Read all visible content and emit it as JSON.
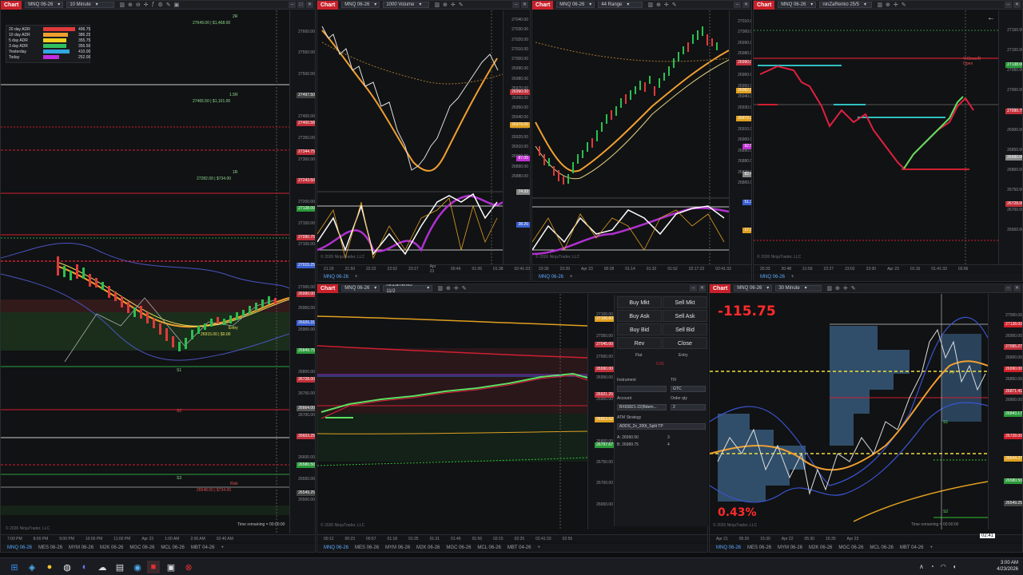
{
  "windows": {
    "w1": {
      "badge": "Chart",
      "instrument": "MNQ 06-26",
      "interval": "10 Minute",
      "adr_rows": [
        {
          "label": "20 day ADR",
          "value": "496.75",
          "color": "#e23a3a",
          "fill": 1.0
        },
        {
          "label": "10 day ADR",
          "value": "386.25",
          "color": "#f0a030",
          "fill": 0.78
        },
        {
          "label": "5 day ADR",
          "value": "355.75",
          "color": "#f0d020",
          "fill": 0.72
        },
        {
          "label": "3 day ADR",
          "value": "356.50",
          "color": "#30c060",
          "fill": 0.72
        },
        {
          "label": "Yesterday",
          "value": "410.00",
          "color": "#30a8e0",
          "fill": 0.83
        },
        {
          "label": "Today",
          "value": "252.00",
          "color": "#c030e0",
          "fill": 0.51
        }
      ],
      "annotations": {
        "r2": "2R",
        "r2v": "27649.00 | $1,468.00",
        "r15": "1.5R",
        "r15v": "27465.50 | $1,101.00",
        "r1": "1R",
        "r1v": "27282.00 | $734.00",
        "entry": "Entry",
        "entryv": "26915.00 | $0.00",
        "s1": "S1",
        "s2": "S2",
        "s3": "S3",
        "risk": "Risk",
        "riskv": "26548.00 | $734.00"
      },
      "ticks": [
        "27600.00",
        "27550.00",
        "27500.00",
        "27450.00",
        "27400.00",
        "27350.00",
        "27300.00",
        "27250.00",
        "27200.00",
        "27150.00",
        "27100.00",
        "27050.00",
        "27000.00",
        "26950.00",
        "26900.00",
        "26850.00",
        "26800.00",
        "26750.00",
        "26700.00",
        "26650.00",
        "26600.00",
        "26550.00",
        "26500.00"
      ],
      "pl": [
        {
          "text": "27497.50",
          "bg": "#444"
        },
        {
          "text": "27400.58",
          "bg": "#c0303a"
        },
        {
          "text": "27344.75",
          "bg": "#c0303a"
        },
        {
          "text": "27243.50",
          "bg": "#c0303a"
        },
        {
          "text": "27138.00",
          "bg": "#2a9a3a"
        },
        {
          "text": "27090.75",
          "bg": "#c0303a"
        },
        {
          "text": "27015.25",
          "bg": "#3a5fd0"
        },
        {
          "text": "26990.00",
          "bg": "#c0303a"
        },
        {
          "text": "26926.31",
          "bg": "#3a5fd0"
        },
        {
          "text": "26849.75",
          "bg": "#2a9a3a"
        },
        {
          "text": "26728.00",
          "bg": "#c0303a"
        },
        {
          "text": "26664.00",
          "bg": "#555"
        },
        {
          "text": "26603.25",
          "bg": "#c0303a"
        },
        {
          "text": "26580.50",
          "bg": "#2a9a3a"
        },
        {
          "text": "26549.25",
          "bg": "#444"
        }
      ],
      "times": [
        "7:00 PM",
        "8:00 PM",
        "9:00 PM",
        "10:00 PM",
        "11:00 PM",
        "Apr 23",
        "1:00 AM",
        "2:00 AM",
        "02:40 AM"
      ],
      "remaining": "Time remaining = 00:00:00",
      "copyright": "© 2026 NinjaTrader, LLC"
    },
    "w2": {
      "badge": "Chart",
      "instrument": "MNQ 06-26",
      "interval": "1000 Volume",
      "ticks": [
        "27040.00",
        "27030.00",
        "27020.00",
        "27010.00",
        "27000.00",
        "26990.00",
        "26980.00",
        "26970.00",
        "26960.00",
        "26950.00",
        "26940.00",
        "26930.00",
        "26920.00",
        "26910.00",
        "26900.00",
        "26890.00",
        "26880.00"
      ],
      "pl": [
        {
          "text": "26990.00",
          "bg": "#c0303a"
        },
        {
          "text": "26979.00",
          "bg": "#e0a020"
        },
        {
          "text": "87.05",
          "bg": "#c030d0"
        },
        {
          "text": "74.33",
          "bg": "#888"
        },
        {
          "text": "38.26",
          "bg": "#3a5fd0"
        }
      ],
      "times": [
        "21:29",
        "21:59",
        "22:22",
        "22:52",
        "23:17",
        "Apr 23",
        "00:46",
        "01:06",
        "01:38",
        "02:41:33"
      ],
      "tab": "MNQ 06-26"
    },
    "w3": {
      "badge": "Chart",
      "instrument": "MNQ 06-26",
      "interval": "44 Range",
      "ticks": [
        "27010.00",
        "27000.00",
        "26990.00",
        "26980.00",
        "26970.00",
        "26960.00",
        "26950.00",
        "26940.00",
        "26930.00",
        "26920.00",
        "26910.00",
        "26900.00",
        "26890.00",
        "26880.00",
        "26870.00",
        "26860.00"
      ],
      "pl": [
        {
          "text": "26990.00",
          "bg": "#c0303a"
        },
        {
          "text": "26982.00",
          "bg": "#e0a020"
        },
        {
          "text": "26972.25",
          "bg": "#e0a020"
        },
        {
          "text": "92.53",
          "bg": "#c030d0"
        },
        {
          "text": "82.49",
          "bg": "#888"
        },
        {
          "text": "51.30",
          "bg": "#3a5fd0"
        },
        {
          "text": "17.13",
          "bg": "#e0a020"
        }
      ],
      "times": [
        "23:30",
        "23:39",
        "Apr 23",
        "00:28",
        "01:14",
        "01:32",
        "01:52",
        "02:17:22",
        "02:41:33"
      ],
      "tab": "MNQ 06-26"
    },
    "w4": {
      "badge": "Chart",
      "instrument": "MNQ 06-26",
      "interval": "ninZaRenko 25/5",
      "ticks": [
        "27150.00",
        "27100.00",
        "27050.00",
        "27000.00",
        "26950.00",
        "26900.00",
        "26850.00",
        "26800.00",
        "26750.00",
        "26700.00",
        "26650.00"
      ],
      "pl": [
        {
          "text": "27138.00",
          "bg": "#2a9a3a"
        },
        {
          "text": "27090.75",
          "bg": "#c0303a"
        },
        {
          "text": "26990.00",
          "bg": "#888"
        },
        {
          "text": "26728.00",
          "bg": "#c0303a"
        }
      ],
      "labels": {
        "yclose": "Y-Close/D",
        "open": "Open"
      },
      "times": [
        "20:33",
        "20:48",
        "21:59",
        "22:27",
        "23:02",
        "23:30",
        "Apr 23",
        "01:16",
        "01:41:33",
        "03:06"
      ],
      "tab": "MNQ 06-26"
    },
    "w5": {
      "badge": "Chart",
      "instrument": "MNQ 06-26",
      "interval": "ninZaRenko 11/2",
      "ticks": [
        "27100.00",
        "27050.00",
        "27000.00",
        "26950.00",
        "26900.00",
        "26850.00",
        "26800.00",
        "26750.00",
        "26700.00",
        "26650.00"
      ],
      "pl": [
        {
          "text": "27106.60",
          "bg": "#e0a020"
        },
        {
          "text": "27045.00",
          "bg": "#c0303a"
        },
        {
          "text": "26990.00",
          "bg": "#c0303a"
        },
        {
          "text": "26921.25",
          "bg": "#c0303a"
        },
        {
          "text": "26853.62",
          "bg": "#e0a020"
        },
        {
          "text": "26797.67",
          "bg": "#2a9a3a"
        }
      ],
      "times": [
        "00:12",
        "00:23",
        "00:57",
        "01:18",
        "01:25",
        "01:31",
        "01:46",
        "01:56",
        "02:15",
        "02:25",
        "02:41:33",
        "02:56"
      ],
      "copyright": "© 2026 NinjaTrader, LLC",
      "atm": {
        "buy_mkt": "Buy Mkt",
        "sell_mkt": "Sell Mkt",
        "buy_ask": "Buy Ask",
        "sell_ask": "Sell Ask",
        "buy_bid": "Buy Bid",
        "sell_bid": "Sell Bid",
        "rev": "Rev",
        "close": "Close",
        "flat": "Flat",
        "entry": "Entry",
        "price": "0.00",
        "instrument_label": "Instrument",
        "tif_label": "TIF",
        "tif": "GTC",
        "account_label": "Account",
        "account": "BX65821-22(Bdem...",
        "qty_label": "Order qty",
        "qty": "2",
        "atm_label": "ATM Strategy",
        "atm": "ADDS_2x_200t_Split TP",
        "a": "A: 26990.50",
        "a_qty": "3",
        "b": "B: 26989.75",
        "b_qty": "4"
      }
    },
    "w6": {
      "badge": "Chart",
      "instrument": "MNQ 06-26",
      "interval": "30 Minute",
      "pnl": "-115.75",
      "pct": "0.43%",
      "pl": [
        {
          "text": "27138.00",
          "bg": "#d0202a"
        },
        {
          "text": "27095.27",
          "bg": "#c0303a"
        },
        {
          "text": "26990.00",
          "bg": "#d0202a"
        },
        {
          "text": "26871.41",
          "bg": "#c0303a"
        },
        {
          "text": "26843.17",
          "bg": "#2a9a3a"
        },
        {
          "text": "26728.00",
          "bg": "#d0202a"
        },
        {
          "text": "26644.37",
          "bg": "#e0a020"
        },
        {
          "text": "26580.50",
          "bg": "#2a9a3a"
        },
        {
          "text": "26549.25",
          "bg": "#444"
        }
      ],
      "ticks": [
        "27000.00",
        "26950.00",
        "26900.00",
        "26850.00",
        "26800.00"
      ],
      "labels": {
        "pp": "PP",
        "s1": "S1",
        "s2": "S2"
      },
      "times": [
        "Apr 21",
        "05:30",
        "15:30",
        "Apr 22",
        "05:30",
        "15:30",
        "Apr 23"
      ],
      "time_now": "02:41",
      "remaining": "Time remaining = 00:00:00",
      "copyright": "© 2026 NinjaTrader, LLC"
    }
  },
  "bottom_tabs": [
    "MNQ 06-26",
    "MES 06-26",
    "MYM 06-26",
    "M2K 06-26",
    "MGC 06-26",
    "MCL 06-26",
    "MBT 04-26"
  ],
  "taskbar": {
    "time": "3:00 AM",
    "date": "4/23/2026"
  }
}
